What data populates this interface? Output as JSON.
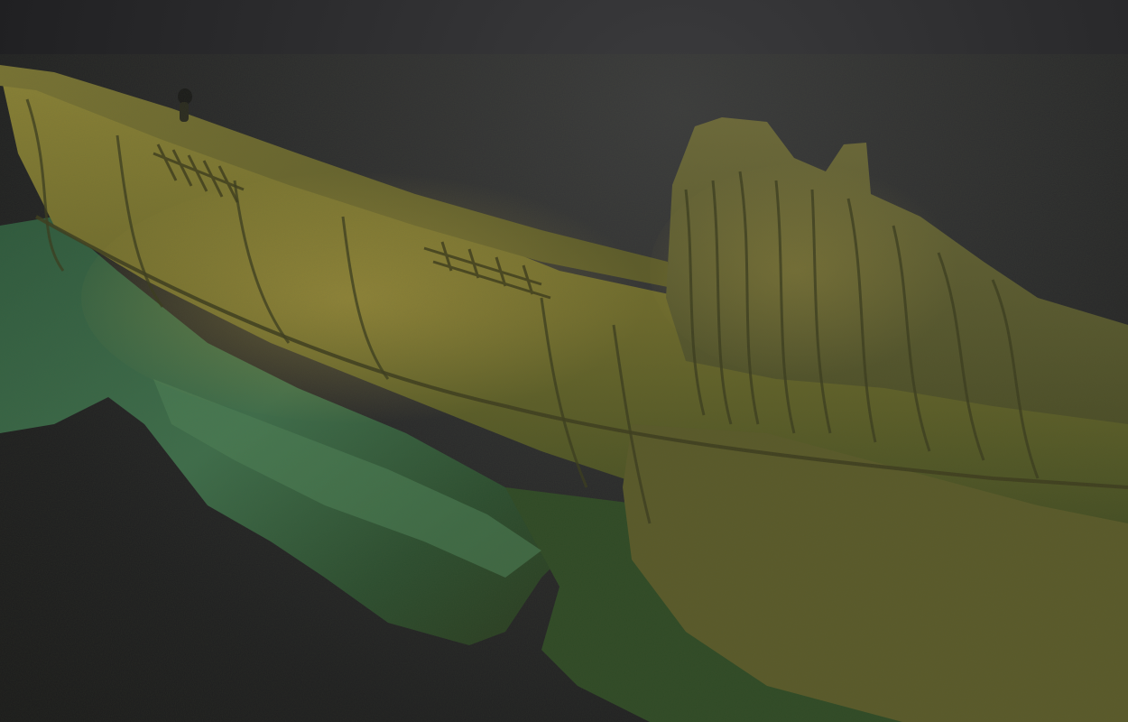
{
  "scene": {
    "subject": "shipwreck-3d-model",
    "colors": {
      "background": "#2a2a2c",
      "hull": "#6b6a2e",
      "hull_highlight": "#9a8f3c",
      "seabed": "#2f5a3c",
      "seabed_light": "#4a7a52",
      "shadow": "#1c2a1a"
    }
  }
}
